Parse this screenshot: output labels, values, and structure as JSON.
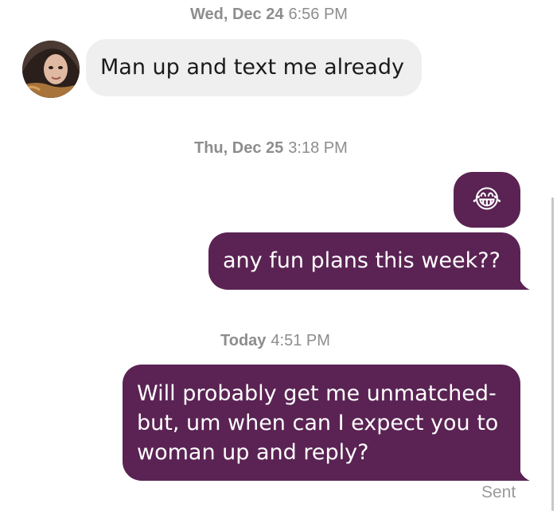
{
  "conversation": {
    "sections": [
      {
        "day": "Wed, Dec 24",
        "time": "6:56 PM"
      },
      {
        "day": "Thu, Dec 25",
        "time": "3:18 PM"
      },
      {
        "day": "Today",
        "time": "4:51 PM"
      }
    ],
    "messages": [
      {
        "from": "match",
        "text": "Man up and text me already"
      },
      {
        "from": "me",
        "text": "😂"
      },
      {
        "from": "me",
        "text": "any fun plans this week??"
      },
      {
        "from": "me",
        "text": "Will probably get me unmatched- but, um when can I expect you to woman up and reply?"
      }
    ],
    "status": "Sent"
  },
  "colors": {
    "outgoing_bubble": "#5a2353",
    "incoming_bubble": "#efefef",
    "timestamp": "#8d8d8d"
  },
  "icons": {
    "avatar": "profile-photo"
  }
}
